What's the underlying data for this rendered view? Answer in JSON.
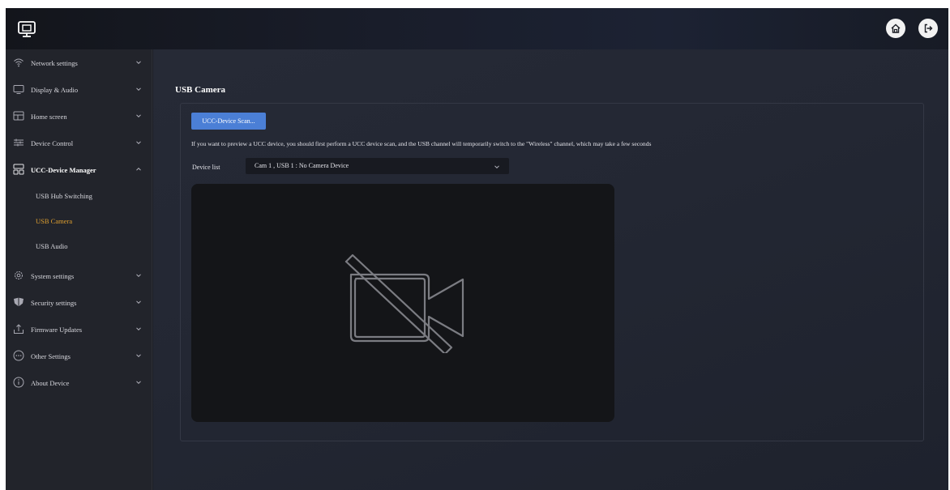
{
  "sidebar": {
    "items": [
      {
        "label": "Network settings",
        "icon": "wifi-icon"
      },
      {
        "label": "Display & Audio",
        "icon": "monitor-icon"
      },
      {
        "label": "Home screen",
        "icon": "home-screen-icon"
      },
      {
        "label": "Device Control",
        "icon": "sliders-icon"
      },
      {
        "label": "UCC-Device Manager",
        "icon": "device-manager-icon",
        "expanded": true
      },
      {
        "label": "System settings",
        "icon": "gear-icon"
      },
      {
        "label": "Security settings",
        "icon": "shield-icon"
      },
      {
        "label": "Firmware Updates",
        "icon": "upload-icon"
      },
      {
        "label": "Other Settings",
        "icon": "more-icon"
      },
      {
        "label": "About Device",
        "icon": "info-icon"
      }
    ],
    "subitems": [
      {
        "label": "USB Hub Switching"
      },
      {
        "label": "USB Camera",
        "active": true
      },
      {
        "label": "USB Audio"
      }
    ]
  },
  "main": {
    "title": "USB Camera",
    "scan_button": "UCC-Device Scan...",
    "info_text": "If you want to preview a UCC device, you should first perform a UCC device scan, and the USB channel will temporarily switch to the \"Wireless\" channel, which may take a few seconds",
    "device_list_label": "Device list",
    "device_list_value": "Cam 1 , USB 1 : No Camera Device"
  },
  "colors": {
    "accent": "#4b7fd6",
    "active_item": "#e0a030",
    "sidebar_bg": "#22242b"
  }
}
